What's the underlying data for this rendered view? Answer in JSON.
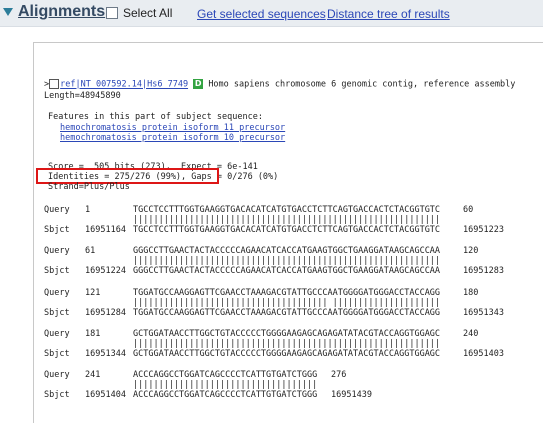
{
  "toolbar": {
    "title": "Alignments",
    "select_all": "Select All",
    "get_selected": "Get selected sequences",
    "distance_tree": "Distance tree of results"
  },
  "hit": {
    "prefix": ">",
    "id": "ref|NT_007592.14|Hs6_7749",
    "badge": "D",
    "description": "Homo sapiens chromosome 6 genomic contig, reference assembly",
    "length": "Length=48945890"
  },
  "features": {
    "heading": "Features in this part of subject sequence:",
    "items": [
      "hemochromatosis protein isoform 11 precursor",
      "hemochromatosis protein isoform 10 precursor"
    ]
  },
  "stats": {
    "score": "Score =  505 bits (273),  Expect = 6e-141",
    "identities": "Identities = 275/276 (99%),",
    "gaps": " Gaps = 0/276 (0%)",
    "strand": "Strand=Plus/Plus"
  },
  "alignment": [
    {
      "q_label": "Query",
      "q_start": "1",
      "q_seq": "TGCCTCCTTTGGTGAAGGTGACACATCATGTGACCTCTTCAGTGACCACTCTACGGTGTC",
      "q_end": "60",
      "match": "||||||||||||||||||||||||||||||||||||||||||||||||||||||||||||",
      "s_label": "Sbjct",
      "s_start": "16951164",
      "s_seq": "TGCCTCCTTTGGTGAAGGTGACACATCATGTGACCTCTTCAGTGACCACTCTACGGTGTC",
      "s_end": "16951223"
    },
    {
      "q_label": "Query",
      "q_start": "61",
      "q_seq": "GGGCCTTGAACTACTACCCCCAGAACATCACCATGAAGTGGCTGAAGGATAAGCAGCCAA",
      "q_end": "120",
      "match": "||||||||||||||||||||||||||||||||||||||||||||||||||||||||||||",
      "s_label": "Sbjct",
      "s_start": "16951224",
      "s_seq": "GGGCCTTGAACTACTACCCCCAGAACATCACCATGAAGTGGCTGAAGGATAAGCAGCCAA",
      "s_end": "16951283"
    },
    {
      "q_label": "Query",
      "q_start": "121",
      "q_seq": "TGGATGCCAAGGAGTTCGAACCTAAAGACGTATTGCCCAATGGGGATGGGACCTACCAGG",
      "q_end": "180",
      "match": "|||||||||||||||||||||||||||||||||||||| |||||||||||||||||||||",
      "s_label": "Sbjct",
      "s_start": "16951284",
      "s_seq": "TGGATGCCAAGGAGTTCGAACCTAAAGACGTATTGCCCAATGGGGATGGGACCTACCAGG",
      "s_end": "16951343"
    },
    {
      "q_label": "Query",
      "q_start": "181",
      "q_seq": "GCTGGATAACCTTGGCTGTACCCCCTGGGGAAGAGCAGAGATATACGTACCAGGTGGAGC",
      "q_end": "240",
      "match": "||||||||||||||||||||||||||||||||||||||||||||||||||||||||||||",
      "s_label": "Sbjct",
      "s_start": "16951344",
      "s_seq": "GCTGGATAACCTTGGCTGTACCCCCTGGGGAAGAGCAGAGATATACGTACCAGGTGGAGC",
      "s_end": "16951403"
    },
    {
      "q_label": "Query",
      "q_start": "241",
      "q_seq": "ACCCAGGCCTGGATCAGCCCCTCATTGTGATCTGGG",
      "q_end": "276",
      "match": "||||||||||||||||||||||||||||||||||||",
      "s_label": "Sbjct",
      "s_start": "16951404",
      "s_seq": "ACCCAGGCCTGGATCAGCCCCTCATTGTGATCTGGG",
      "s_end": "16951439"
    }
  ]
}
